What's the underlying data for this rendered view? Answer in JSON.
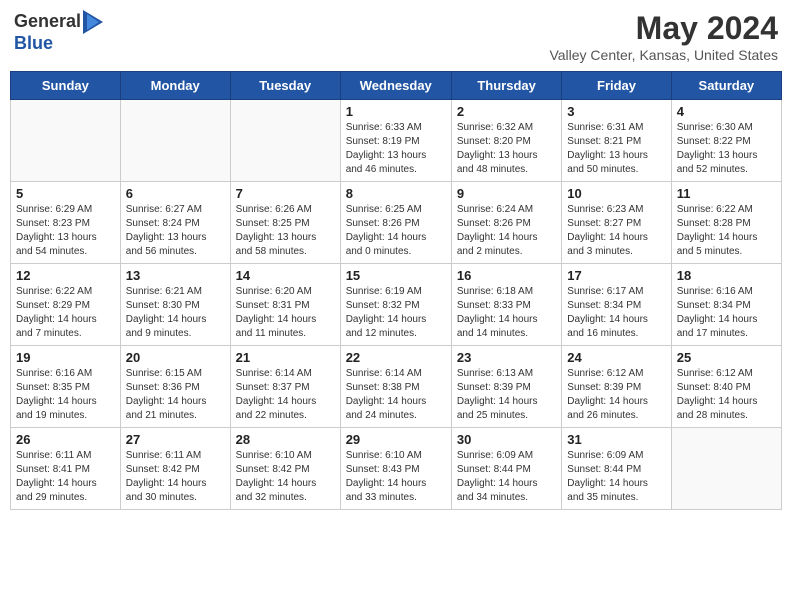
{
  "header": {
    "logo_general": "General",
    "logo_blue": "Blue",
    "month_title": "May 2024",
    "location": "Valley Center, Kansas, United States"
  },
  "weekdays": [
    "Sunday",
    "Monday",
    "Tuesday",
    "Wednesday",
    "Thursday",
    "Friday",
    "Saturday"
  ],
  "weeks": [
    [
      {
        "day": "",
        "info": ""
      },
      {
        "day": "",
        "info": ""
      },
      {
        "day": "",
        "info": ""
      },
      {
        "day": "1",
        "info": "Sunrise: 6:33 AM\nSunset: 8:19 PM\nDaylight: 13 hours\nand 46 minutes."
      },
      {
        "day": "2",
        "info": "Sunrise: 6:32 AM\nSunset: 8:20 PM\nDaylight: 13 hours\nand 48 minutes."
      },
      {
        "day": "3",
        "info": "Sunrise: 6:31 AM\nSunset: 8:21 PM\nDaylight: 13 hours\nand 50 minutes."
      },
      {
        "day": "4",
        "info": "Sunrise: 6:30 AM\nSunset: 8:22 PM\nDaylight: 13 hours\nand 52 minutes."
      }
    ],
    [
      {
        "day": "5",
        "info": "Sunrise: 6:29 AM\nSunset: 8:23 PM\nDaylight: 13 hours\nand 54 minutes."
      },
      {
        "day": "6",
        "info": "Sunrise: 6:27 AM\nSunset: 8:24 PM\nDaylight: 13 hours\nand 56 minutes."
      },
      {
        "day": "7",
        "info": "Sunrise: 6:26 AM\nSunset: 8:25 PM\nDaylight: 13 hours\nand 58 minutes."
      },
      {
        "day": "8",
        "info": "Sunrise: 6:25 AM\nSunset: 8:26 PM\nDaylight: 14 hours\nand 0 minutes."
      },
      {
        "day": "9",
        "info": "Sunrise: 6:24 AM\nSunset: 8:26 PM\nDaylight: 14 hours\nand 2 minutes."
      },
      {
        "day": "10",
        "info": "Sunrise: 6:23 AM\nSunset: 8:27 PM\nDaylight: 14 hours\nand 3 minutes."
      },
      {
        "day": "11",
        "info": "Sunrise: 6:22 AM\nSunset: 8:28 PM\nDaylight: 14 hours\nand 5 minutes."
      }
    ],
    [
      {
        "day": "12",
        "info": "Sunrise: 6:22 AM\nSunset: 8:29 PM\nDaylight: 14 hours\nand 7 minutes."
      },
      {
        "day": "13",
        "info": "Sunrise: 6:21 AM\nSunset: 8:30 PM\nDaylight: 14 hours\nand 9 minutes."
      },
      {
        "day": "14",
        "info": "Sunrise: 6:20 AM\nSunset: 8:31 PM\nDaylight: 14 hours\nand 11 minutes."
      },
      {
        "day": "15",
        "info": "Sunrise: 6:19 AM\nSunset: 8:32 PM\nDaylight: 14 hours\nand 12 minutes."
      },
      {
        "day": "16",
        "info": "Sunrise: 6:18 AM\nSunset: 8:33 PM\nDaylight: 14 hours\nand 14 minutes."
      },
      {
        "day": "17",
        "info": "Sunrise: 6:17 AM\nSunset: 8:34 PM\nDaylight: 14 hours\nand 16 minutes."
      },
      {
        "day": "18",
        "info": "Sunrise: 6:16 AM\nSunset: 8:34 PM\nDaylight: 14 hours\nand 17 minutes."
      }
    ],
    [
      {
        "day": "19",
        "info": "Sunrise: 6:16 AM\nSunset: 8:35 PM\nDaylight: 14 hours\nand 19 minutes."
      },
      {
        "day": "20",
        "info": "Sunrise: 6:15 AM\nSunset: 8:36 PM\nDaylight: 14 hours\nand 21 minutes."
      },
      {
        "day": "21",
        "info": "Sunrise: 6:14 AM\nSunset: 8:37 PM\nDaylight: 14 hours\nand 22 minutes."
      },
      {
        "day": "22",
        "info": "Sunrise: 6:14 AM\nSunset: 8:38 PM\nDaylight: 14 hours\nand 24 minutes."
      },
      {
        "day": "23",
        "info": "Sunrise: 6:13 AM\nSunset: 8:39 PM\nDaylight: 14 hours\nand 25 minutes."
      },
      {
        "day": "24",
        "info": "Sunrise: 6:12 AM\nSunset: 8:39 PM\nDaylight: 14 hours\nand 26 minutes."
      },
      {
        "day": "25",
        "info": "Sunrise: 6:12 AM\nSunset: 8:40 PM\nDaylight: 14 hours\nand 28 minutes."
      }
    ],
    [
      {
        "day": "26",
        "info": "Sunrise: 6:11 AM\nSunset: 8:41 PM\nDaylight: 14 hours\nand 29 minutes."
      },
      {
        "day": "27",
        "info": "Sunrise: 6:11 AM\nSunset: 8:42 PM\nDaylight: 14 hours\nand 30 minutes."
      },
      {
        "day": "28",
        "info": "Sunrise: 6:10 AM\nSunset: 8:42 PM\nDaylight: 14 hours\nand 32 minutes."
      },
      {
        "day": "29",
        "info": "Sunrise: 6:10 AM\nSunset: 8:43 PM\nDaylight: 14 hours\nand 33 minutes."
      },
      {
        "day": "30",
        "info": "Sunrise: 6:09 AM\nSunset: 8:44 PM\nDaylight: 14 hours\nand 34 minutes."
      },
      {
        "day": "31",
        "info": "Sunrise: 6:09 AM\nSunset: 8:44 PM\nDaylight: 14 hours\nand 35 minutes."
      },
      {
        "day": "",
        "info": ""
      }
    ]
  ]
}
